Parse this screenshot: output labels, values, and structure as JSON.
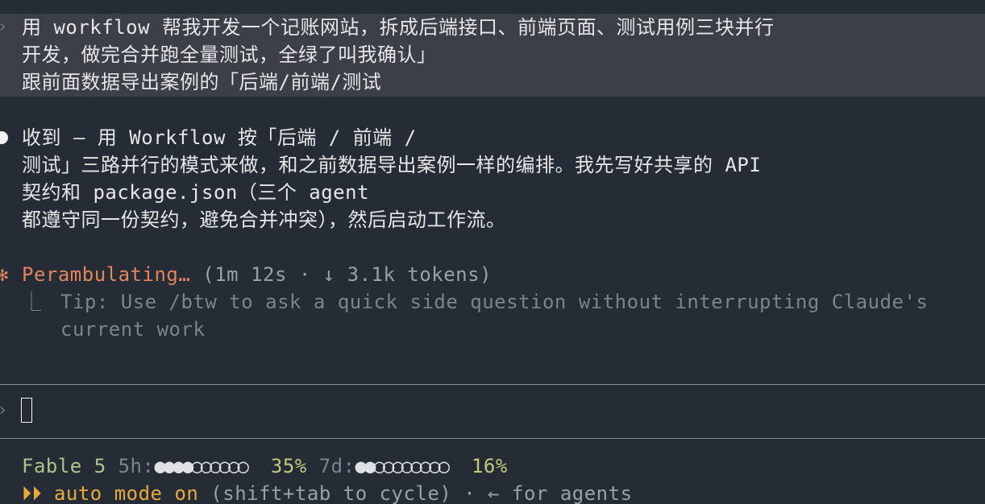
{
  "user_message": {
    "lines": [
      "用 workflow 帮我开发一个记账网站，拆成后端接口、前端页面、测试用例三块并行",
      "开发，做完合并跑全量测试，全绿了叫我确认」",
      "跟前面数据导出案例的「后端/前端/测试"
    ]
  },
  "assistant_message": {
    "lines": [
      "收到 — 用 Workflow 按「后端 / 前端 /",
      "测试」三路并行的模式来做，和之前数据导出案例一样的编排。我先写好共享的 API",
      "契约和 package.json（三个 agent",
      "都遵守同一份契约，避免合并冲突），然后启动工作流。"
    ]
  },
  "status": {
    "spinner_glyph": "✻",
    "verb": "Perambulating…",
    "meta": "(1m 12s · ↓ 3.1k tokens)",
    "tip_glyph": "⎿",
    "tip_line1": "Tip: Use /btw to ask a quick side question without interrupting Claude's",
    "tip_line2": "current work"
  },
  "input": {
    "prompt_glyph": "›",
    "value": ""
  },
  "footer": {
    "model": "Fable 5",
    "usage_5h_label": "5h:",
    "usage_5h_filled": "●●●●",
    "usage_5h_empty": "○○○○○○",
    "usage_5h_pct": "35%",
    "usage_7d_label": "7d:",
    "usage_7d_filled": "●●",
    "usage_7d_empty": "○○○○○○○○",
    "usage_7d_pct": "16%",
    "mode_glyph": "⏵⏵",
    "mode_label": "auto mode on",
    "mode_hint": "(shift+tab to cycle) · ← for agents"
  }
}
